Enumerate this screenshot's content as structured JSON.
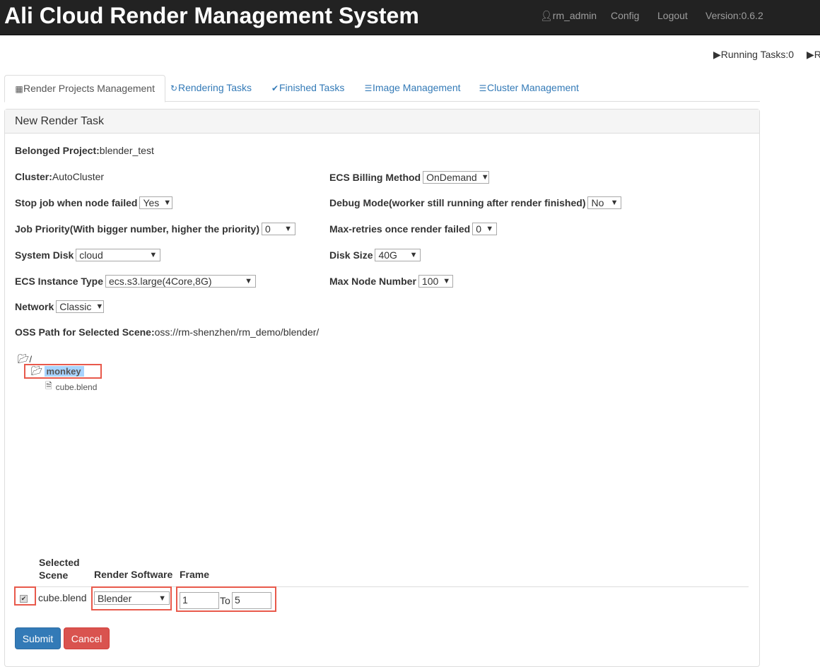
{
  "navbar": {
    "title": "Ali Cloud Render Management System",
    "user": "rm_admin",
    "config": "Config",
    "logout": "Logout",
    "version": "Version:0.6.2"
  },
  "status": {
    "running": "Running Tasks:0",
    "second": "R"
  },
  "tabs": [
    {
      "label": "Render Projects Management",
      "icon": "grid-icon"
    },
    {
      "label": "Rendering Tasks",
      "icon": "refresh-icon"
    },
    {
      "label": "Finished Tasks",
      "icon": "check-circle-icon"
    },
    {
      "label": "Image Management",
      "icon": "list-icon"
    },
    {
      "label": "Cluster Management",
      "icon": "list-icon"
    }
  ],
  "panel": {
    "title": "New Render Task"
  },
  "form": {
    "project_label": "Belonged Project:",
    "project": "blender_test",
    "cluster_label": "Cluster:",
    "cluster": "AutoCluster",
    "billing_label": "ECS Billing Method",
    "billing": "OnDemand",
    "stopjob_label": "Stop job when node failed",
    "stopjob": "Yes",
    "debug_label": "Debug Mode(worker still running after render finished)",
    "debug": "No",
    "priority_label": "Job Priority(With bigger number, higher the priority)",
    "priority": "0",
    "retries_label": "Max-retries once render failed",
    "retries": "0",
    "disk_label": "System Disk",
    "disk": "cloud",
    "disksize_label": "Disk Size",
    "disksize": "40G",
    "instance_label": "ECS Instance Type",
    "instance": "ecs.s3.large(4Core,8G)",
    "maxnode_label": "Max Node Number",
    "maxnode": "100",
    "network_label": "Network",
    "network": "Classic",
    "oss_label": "OSS Path for Selected Scene:",
    "oss": "oss://rm-shenzhen/rm_demo/blender/"
  },
  "tree": {
    "root": "/",
    "folder": "monkey",
    "file": "cube.blend"
  },
  "scene_table": {
    "headers": [
      "Selected Scene",
      "Render Software",
      "Frame"
    ],
    "scene": "cube.blend",
    "checked": true,
    "software": "Blender",
    "frame_from": "1",
    "to_label": "To",
    "frame_to": "5"
  },
  "buttons": {
    "submit": "Submit",
    "cancel": "Cancel",
    "submit_color": "#337ab7",
    "cancel_color": "#d9534f"
  }
}
